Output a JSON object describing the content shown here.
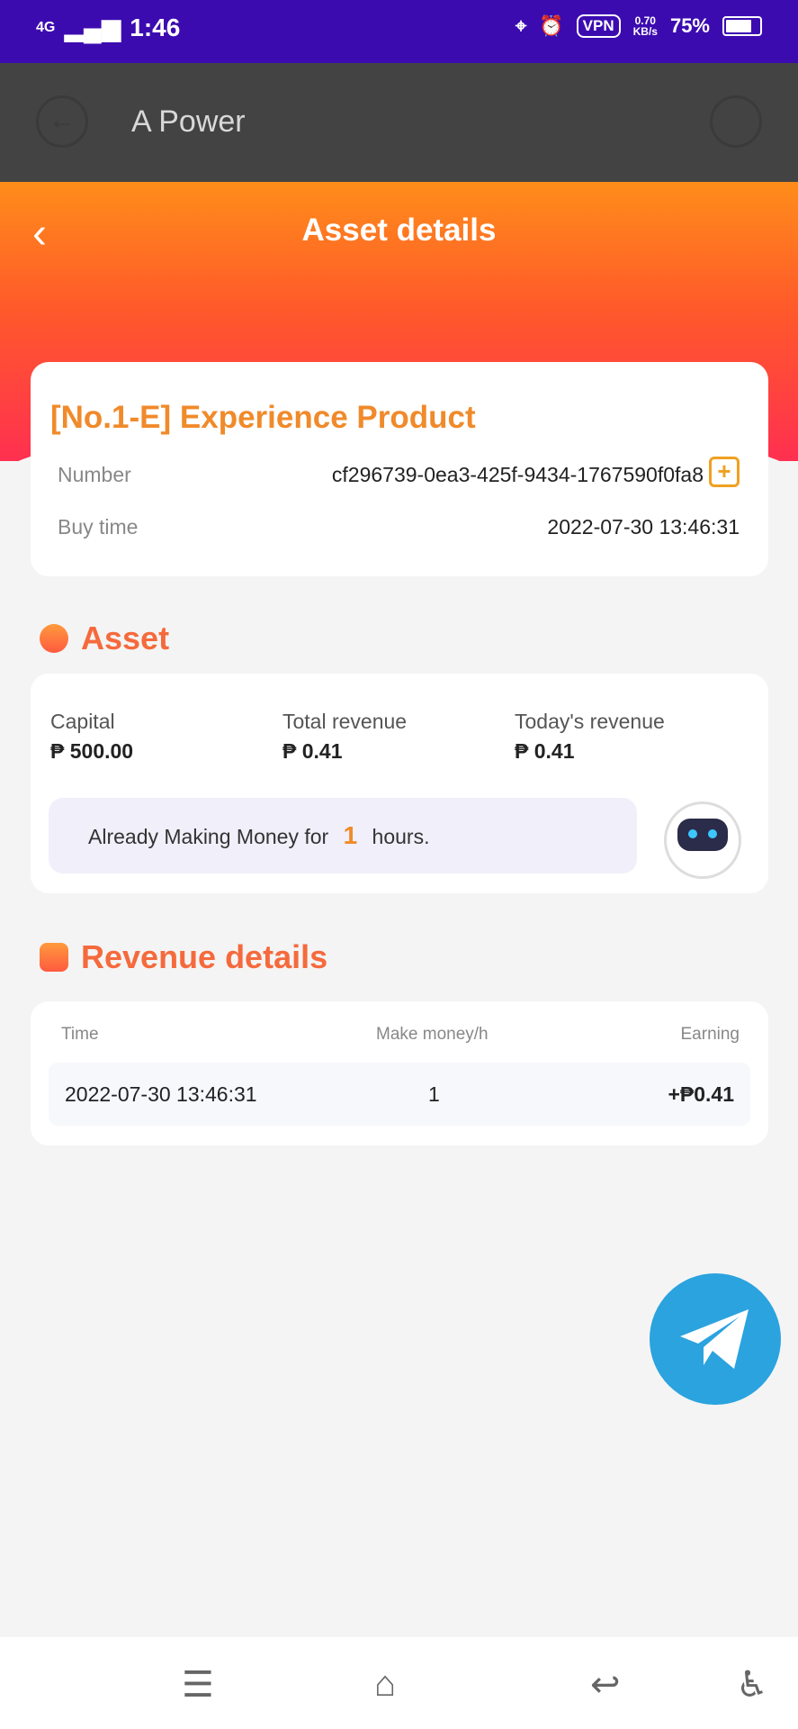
{
  "status_bar": {
    "network": "4G",
    "time": "1:46",
    "vpn": "VPN",
    "speed_value": "0.70",
    "speed_unit": "KB/s",
    "battery": "75%"
  },
  "app_bar": {
    "title": "A Power"
  },
  "page": {
    "title": "Asset details"
  },
  "product": {
    "name": "[No.1-E] Experience Product",
    "number_label": "Number",
    "number_value": "cf296739-0ea3-425f-9434-1767590f0fa8",
    "buy_time_label": "Buy time",
    "buy_time_value": "2022-07-30 13:46:31"
  },
  "asset": {
    "section_title": "Asset",
    "capital_label": "Capital",
    "capital_value": "₱ 500.00",
    "total_revenue_label": "Total revenue",
    "total_revenue_value": "₱ 0.41",
    "today_revenue_label": "Today's revenue",
    "today_revenue_value": "₱ 0.41",
    "making_prefix": "Already Making Money for",
    "making_hours": "1",
    "making_suffix": "hours."
  },
  "revenue": {
    "section_title": "Revenue details",
    "col_time": "Time",
    "col_rate": "Make money/h",
    "col_earning": "Earning",
    "rows": [
      {
        "time": "2022-07-30 13:46:31",
        "rate": "1",
        "earning": "+₱0.41"
      }
    ]
  },
  "colors": {
    "accent": "#f08a2a",
    "earning_green": "#1ec07a",
    "status_bar": "#3c0bb0",
    "telegram": "#2aa3df"
  }
}
